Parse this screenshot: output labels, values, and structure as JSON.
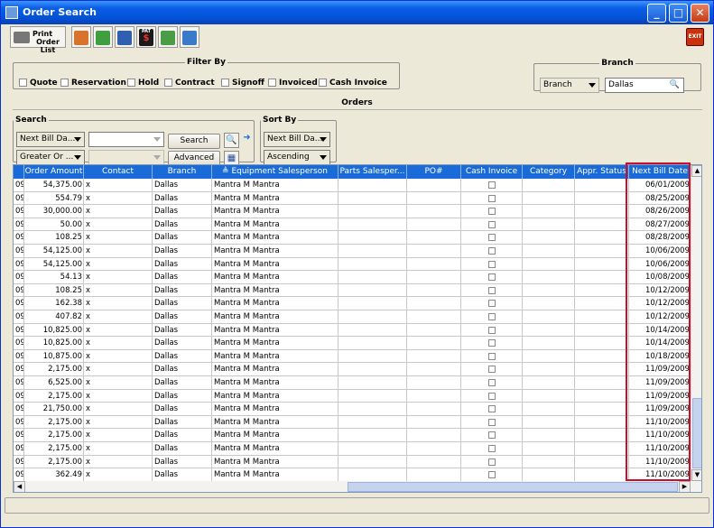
{
  "window": {
    "title": "Order Search",
    "minimize_label": "_",
    "maximize_label": "□",
    "close_label": "✕"
  },
  "toolbar": {
    "print_label_line1": "Print",
    "print_label_line2": "Order List",
    "exit_label": "EXIT",
    "tool_icons": [
      "print-order-list-icon",
      "truck-icon",
      "calculator-icon",
      "parts-icon",
      "dollar-icon",
      "export-icon",
      "refresh-icon"
    ],
    "dollar_text": "$",
    "pat_text": "PAT"
  },
  "filter": {
    "legend": "Filter By",
    "items": [
      "Quote",
      "Reservation",
      "Hold",
      "Contract",
      "Signoff",
      "Invoiced",
      "Cash Invoice"
    ]
  },
  "branch_group": {
    "legend": "Branch",
    "selector": "Branch",
    "value": "Dallas",
    "search_glyph": "🔍"
  },
  "orders_label": "Orders",
  "search": {
    "legend": "Search",
    "field": "Next Bill Da...",
    "operator": "Greater Or ...",
    "value": "",
    "search_button": "Search",
    "advanced_button": "Advanced",
    "find_glyph": "🔍",
    "next_glyph": "➜",
    "report_glyph": "▦"
  },
  "sort": {
    "legend": "Sort By",
    "field": "Next Bill Da...",
    "direction": "Ascending"
  },
  "grid": {
    "sort_arrow": "≜",
    "columns": [
      "",
      "Order Amount",
      "Contact",
      "Branch",
      "Equipment Salesperson",
      "Parts Salesper...",
      "PO#",
      "Cash Invoice",
      "Category",
      "Appr. Status",
      "Next Bill Date"
    ],
    "rows": [
      [
        "09",
        "54,375.00",
        "x",
        "Dallas",
        "Mantra M Mantra",
        "06/01/2009"
      ],
      [
        "09",
        "554.79",
        "x",
        "Dallas",
        "Mantra M Mantra",
        "08/25/2009"
      ],
      [
        "09",
        "30,000.00",
        "x",
        "Dallas",
        "Mantra M Mantra",
        "08/26/2009"
      ],
      [
        "09",
        "50.00",
        "x",
        "Dallas",
        "Mantra M Mantra",
        "08/27/2009"
      ],
      [
        "09",
        "108.25",
        "x",
        "Dallas",
        "Mantra M Mantra",
        "08/28/2009"
      ],
      [
        "09",
        "54,125.00",
        "x",
        "Dallas",
        "Mantra M Mantra",
        "10/06/2009"
      ],
      [
        "09",
        "54,125.00",
        "x",
        "Dallas",
        "Mantra M Mantra",
        "10/06/2009"
      ],
      [
        "09",
        "54.13",
        "x",
        "Dallas",
        "Mantra M Mantra",
        "10/08/2009"
      ],
      [
        "09",
        "108.25",
        "x",
        "Dallas",
        "Mantra M Mantra",
        "10/12/2009"
      ],
      [
        "09",
        "162.38",
        "x",
        "Dallas",
        "Mantra M Mantra",
        "10/12/2009"
      ],
      [
        "09",
        "407.82",
        "x",
        "Dallas",
        "Mantra M Mantra",
        "10/12/2009"
      ],
      [
        "09",
        "10,825.00",
        "x",
        "Dallas",
        "Mantra M Mantra",
        "10/14/2009"
      ],
      [
        "09",
        "10,825.00",
        "x",
        "Dallas",
        "Mantra M Mantra",
        "10/14/2009"
      ],
      [
        "09",
        "10,875.00",
        "x",
        "Dallas",
        "Mantra M Mantra",
        "10/18/2009"
      ],
      [
        "09",
        "2,175.00",
        "x",
        "Dallas",
        "Mantra M Mantra",
        "11/09/2009"
      ],
      [
        "09",
        "6,525.00",
        "x",
        "Dallas",
        "Mantra M Mantra",
        "11/09/2009"
      ],
      [
        "09",
        "2,175.00",
        "x",
        "Dallas",
        "Mantra M Mantra",
        "11/09/2009"
      ],
      [
        "09",
        "21,750.00",
        "x",
        "Dallas",
        "Mantra M Mantra",
        "11/09/2009"
      ],
      [
        "09",
        "2,175.00",
        "x",
        "Dallas",
        "Mantra M Mantra",
        "11/10/2009"
      ],
      [
        "09",
        "2,175.00",
        "x",
        "Dallas",
        "Mantra M Mantra",
        "11/10/2009"
      ],
      [
        "09",
        "2,175.00",
        "x",
        "Dallas",
        "Mantra M Mantra",
        "11/10/2009"
      ],
      [
        "09",
        "2,175.00",
        "x",
        "Dallas",
        "Mantra M Mantra",
        "11/10/2009"
      ],
      [
        "09",
        "362.49",
        "x",
        "Dallas",
        "Mantra M Mantra",
        "11/10/2009"
      ]
    ]
  },
  "scroll": {
    "up": "▲",
    "down": "▼",
    "left": "◀",
    "right": "▶"
  },
  "colors": {
    "title_bar": "#0453d8",
    "grid_header": "#1a6bd8",
    "highlight": "#c8102e"
  }
}
